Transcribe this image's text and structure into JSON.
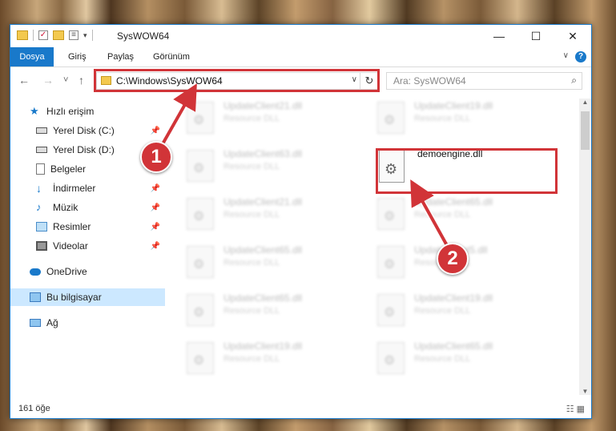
{
  "window": {
    "title": "SysWOW64",
    "minimize": "—",
    "maximize": "☐",
    "close": "✕"
  },
  "ribbon": {
    "tabs": [
      "Dosya",
      "Giriş",
      "Paylaş",
      "Görünüm"
    ],
    "help": "?"
  },
  "nav": {
    "back": "←",
    "forward": "→",
    "recent": "˅",
    "up": "↑"
  },
  "address": {
    "path": "C:\\Windows\\SysWOW64",
    "dropdown": "∨",
    "refresh": "↻"
  },
  "search": {
    "placeholder": "Ara: SysWOW64"
  },
  "sidebar": {
    "items": [
      {
        "label": "Hızlı erişim",
        "icon": "star-icon",
        "pinned": false
      },
      {
        "label": "Yerel Disk (C:)",
        "icon": "drive-icon",
        "pinned": true
      },
      {
        "label": "Yerel Disk (D:)",
        "icon": "drive-icon",
        "pinned": false
      },
      {
        "label": "Belgeler",
        "icon": "document-icon",
        "pinned": true
      },
      {
        "label": "İndirmeler",
        "icon": "download-icon",
        "pinned": true
      },
      {
        "label": "Müzik",
        "icon": "music-icon",
        "pinned": true
      },
      {
        "label": "Resimler",
        "icon": "picture-icon",
        "pinned": true
      },
      {
        "label": "Videolar",
        "icon": "video-icon",
        "pinned": true
      },
      {
        "label": "OneDrive",
        "icon": "cloud-icon",
        "pinned": false
      },
      {
        "label": "Bu bilgisayar",
        "icon": "computer-icon",
        "pinned": false,
        "selected": true
      },
      {
        "label": "Ağ",
        "icon": "network-icon",
        "pinned": false
      }
    ]
  },
  "files": {
    "type_label": "Resource DLL",
    "left": [
      "UpdateClient21.dll",
      "UpdateClient63.dll",
      "UpdateClient21.dll",
      "UpdateClient65.dll",
      "UpdateClient65.dll",
      "UpdateClient19.dll"
    ],
    "right": [
      "UpdateClient19.dll",
      "UpdateClient65.dll",
      "UpdateClient5.dll",
      "UpdateClient19.dll",
      "UpdateClient65.dll"
    ],
    "highlighted": "demoengine.dll"
  },
  "status": {
    "count": "161 öğe"
  },
  "annotations": {
    "step1": "1",
    "step2": "2",
    "color": "#d13438"
  }
}
